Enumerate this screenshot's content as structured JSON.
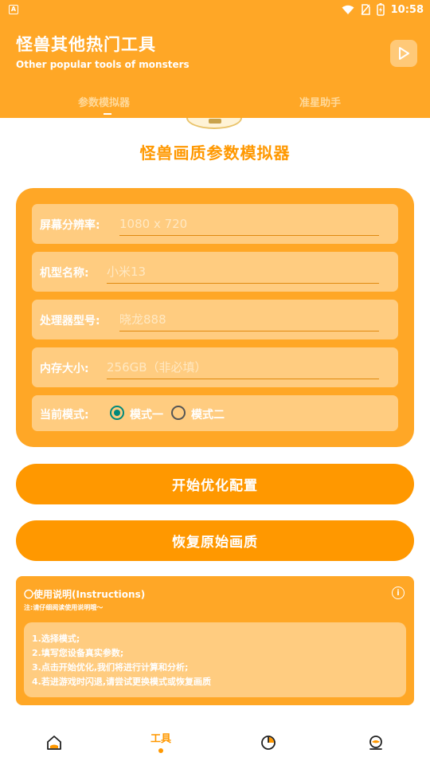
{
  "status_bar": {
    "time": "10:58",
    "icons": [
      "app-icon",
      "wifi-icon",
      "no-sim-icon",
      "battery-charging-icon"
    ]
  },
  "header": {
    "title_zh": "怪兽其他热门工具",
    "title_en": "Other popular tools of monsters",
    "play_icon": "play-icon"
  },
  "tabs": [
    {
      "label": "参数模拟器",
      "active": true
    },
    {
      "label": "准星助手",
      "active": false
    }
  ],
  "main": {
    "title": "怪兽画质参数模拟器"
  },
  "form": {
    "fields": [
      {
        "label": "屏幕分辨率:",
        "placeholder": "1080 x 720",
        "value": ""
      },
      {
        "label": "机型名称:",
        "placeholder": "小米13",
        "value": ""
      },
      {
        "label": "处理器型号:",
        "placeholder": "晓龙888",
        "value": ""
      },
      {
        "label": "内存大小:",
        "placeholder": "256GB（非必填）",
        "value": ""
      }
    ],
    "mode": {
      "label": "当前模式:",
      "options": [
        "模式一",
        "模式二"
      ],
      "selected": "模式一"
    }
  },
  "buttons": {
    "start": "开始优化配置",
    "restore": "恢复原始画质"
  },
  "instructions": {
    "title": "〇使用说明(Instructions)",
    "note": "注:请仔细阅读使用说明哦～",
    "steps": [
      "1.选择模式;",
      "2.填写您设备真实参数;",
      "3.点击开始优化,我们将进行计算和分析;",
      "4.若进游戏时闪退,请尝试更换模式或恢复画质"
    ]
  },
  "bottom_nav": {
    "items": [
      {
        "icon": "home-icon",
        "label": "",
        "active": false
      },
      {
        "icon": "",
        "label": "工具",
        "active": true
      },
      {
        "icon": "pie-chart-icon",
        "label": "",
        "active": false
      },
      {
        "icon": "profile-icon",
        "label": "",
        "active": false
      }
    ]
  },
  "colors": {
    "primary": "#FFA726",
    "accent": "#FF9800",
    "field_bg": "#FFCC80",
    "radio_checked": "#00897B"
  }
}
